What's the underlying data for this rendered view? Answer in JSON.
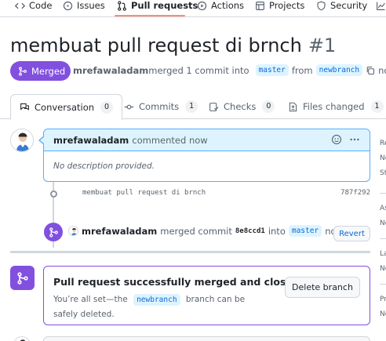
{
  "repo_nav": {
    "items": [
      {
        "label": "Code",
        "icon": "code-icon"
      },
      {
        "label": "Issues",
        "icon": "issue-icon"
      },
      {
        "label": "Pull requests",
        "icon": "pull-request-icon"
      },
      {
        "label": "Actions",
        "icon": "play-icon"
      },
      {
        "label": "Projects",
        "icon": "table-icon"
      },
      {
        "label": "Security",
        "icon": "shield-icon"
      }
    ],
    "active": "Pull requests"
  },
  "pr": {
    "title": "membuat pull request di brnch",
    "number": "#1",
    "state": "Merged",
    "author": "mrefawaladam",
    "merged_text": "merged 1 commit into",
    "base_branch": "master",
    "from_text": "from",
    "head_branch": "newbranch",
    "when": "now"
  },
  "tabs": [
    {
      "label": "Conversation",
      "count": "0",
      "icon": "comment-discussion-icon"
    },
    {
      "label": "Commits",
      "count": "1",
      "icon": "commit-icon"
    },
    {
      "label": "Checks",
      "count": "0",
      "icon": "checklist-icon"
    },
    {
      "label": "Files changed",
      "count": "1",
      "icon": "file-diff-icon"
    }
  ],
  "comment": {
    "author": "mrefawaladam",
    "action": "commented now",
    "body": "No description provided."
  },
  "commit": {
    "message": "membuat pull request di brnch",
    "sha": "787f292"
  },
  "merge_event": {
    "author": "mrefawaladam",
    "text": "merged commit",
    "sha": "8e8ccd1",
    "into": "into",
    "branch": "master",
    "when": "now",
    "revert_label": "Revert"
  },
  "merged_box": {
    "title": "Pull request successfully merged and closed",
    "desc_prefix": "You’re all set—the",
    "branch": "newbranch",
    "desc_suffix": "branch can be safely deleted.",
    "delete_label": "Delete branch"
  },
  "sidebar": {
    "fragments": [
      "Re",
      "No",
      "St",
      "As",
      "No",
      "La",
      "No",
      "Pr",
      "No"
    ]
  },
  "colors": {
    "merged_purple": "#8250df",
    "link_blue": "#0969da",
    "branch_bg": "#ddf4ff",
    "nav_underline": "#fd8c73"
  }
}
